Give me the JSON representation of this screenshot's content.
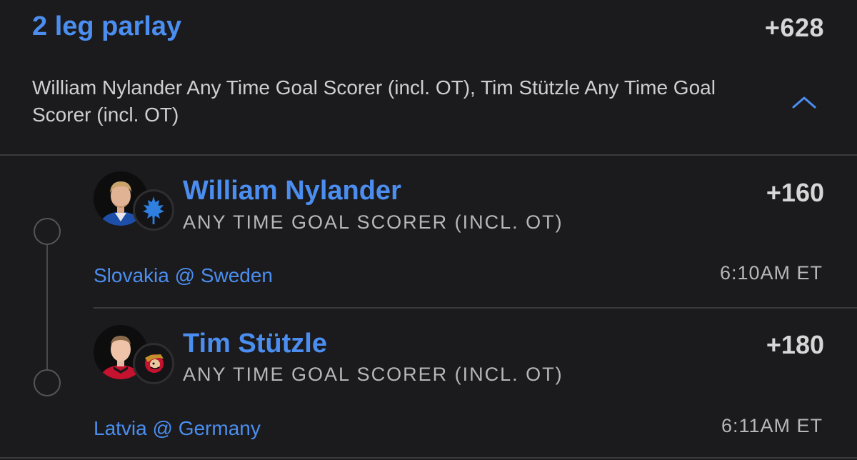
{
  "parlay": {
    "title": "2 leg parlay",
    "odds": "+628",
    "description": "William Nylander Any Time Goal Scorer (incl. OT), Tim Stützle Any Time Goal Scorer (incl. OT)",
    "collapse_icon": "chevron-up-icon"
  },
  "legs": [
    {
      "player": "William Nylander",
      "market": "ANY TIME GOAL SCORER (INCL. OT)",
      "odds": "+160",
      "matchup": "Slovakia @ Sweden",
      "time": "6:10AM ET",
      "team_logo": "maple-leafs-logo"
    },
    {
      "player": "Tim Stützle",
      "market": "ANY TIME GOAL SCORER (INCL. OT)",
      "odds": "+180",
      "matchup": "Latvia @ Germany",
      "time": "6:11AM ET",
      "team_logo": "senators-logo"
    }
  ],
  "colors": {
    "background": "#1b1b1d",
    "accent_blue": "#4b8ef0",
    "primary_text": "#d6d6d6",
    "secondary_text": "#b7b7b7",
    "divider": "#3a3a3c"
  }
}
